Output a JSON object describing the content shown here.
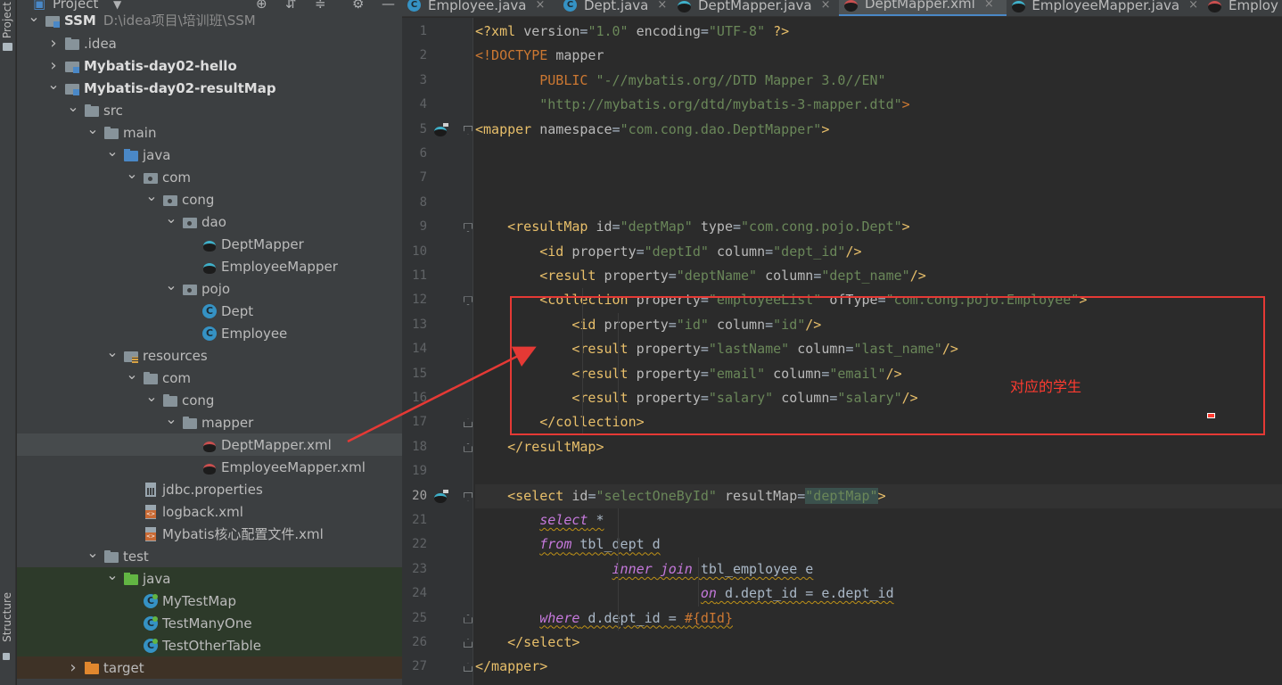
{
  "left_strip": {
    "project_label": "Project",
    "structure_label": "Structure"
  },
  "project_panel": {
    "title": "Project",
    "dropdown_icon": "chevron-down-icon",
    "toolbar_icons": [
      "target-icon",
      "collapse-all-icon",
      "expand-icon",
      "gear-icon",
      "minimize-icon"
    ],
    "tree": [
      {
        "label": "SSM",
        "path": "D:\\idea项目\\培训班\\SSM",
        "icon": "module",
        "depth": 0,
        "arrow": "down",
        "bold": true
      },
      {
        "label": ".idea",
        "icon": "folder",
        "depth": 1,
        "arrow": "right"
      },
      {
        "label": "Mybatis-day02-hello",
        "icon": "module",
        "depth": 1,
        "arrow": "right",
        "bold": true
      },
      {
        "label": "Mybatis-day02-resultMap",
        "icon": "module",
        "depth": 1,
        "arrow": "down",
        "bold": true
      },
      {
        "label": "src",
        "icon": "folder",
        "depth": 2,
        "arrow": "down"
      },
      {
        "label": "main",
        "icon": "folder",
        "depth": 3,
        "arrow": "down"
      },
      {
        "label": "java",
        "icon": "folder-src",
        "depth": 4,
        "arrow": "down"
      },
      {
        "label": "com",
        "icon": "folder-pkg",
        "depth": 5,
        "arrow": "down"
      },
      {
        "label": "cong",
        "icon": "folder-pkg",
        "depth": 6,
        "arrow": "down"
      },
      {
        "label": "dao",
        "icon": "folder-pkg",
        "depth": 7,
        "arrow": "down"
      },
      {
        "label": "DeptMapper",
        "icon": "mybatis",
        "depth": 8,
        "arrow": "none"
      },
      {
        "label": "EmployeeMapper",
        "icon": "mybatis",
        "depth": 8,
        "arrow": "none"
      },
      {
        "label": "pojo",
        "icon": "folder-pkg",
        "depth": 7,
        "arrow": "down"
      },
      {
        "label": "Dept",
        "icon": "class",
        "depth": 8,
        "arrow": "none"
      },
      {
        "label": "Employee",
        "icon": "class",
        "depth": 8,
        "arrow": "none"
      },
      {
        "label": "resources",
        "icon": "folder-res",
        "depth": 4,
        "arrow": "down"
      },
      {
        "label": "com",
        "icon": "folder",
        "depth": 5,
        "arrow": "down"
      },
      {
        "label": "cong",
        "icon": "folder",
        "depth": 6,
        "arrow": "down"
      },
      {
        "label": "mapper",
        "icon": "folder",
        "depth": 7,
        "arrow": "down"
      },
      {
        "label": "DeptMapper.xml",
        "icon": "mybatis-xml",
        "depth": 8,
        "arrow": "none",
        "selected": true
      },
      {
        "label": "EmployeeMapper.xml",
        "icon": "mybatis-xml",
        "depth": 8,
        "arrow": "none"
      },
      {
        "label": "jdbc.properties",
        "icon": "props",
        "depth": 5,
        "arrow": "none"
      },
      {
        "label": "logback.xml",
        "icon": "xml",
        "depth": 5,
        "arrow": "none"
      },
      {
        "label": "Mybatis核心配置文件.xml",
        "icon": "xml",
        "depth": 5,
        "arrow": "none"
      },
      {
        "label": "test",
        "icon": "folder",
        "depth": 3,
        "arrow": "down"
      },
      {
        "label": "java",
        "icon": "folder-test",
        "depth": 4,
        "arrow": "down",
        "test": true
      },
      {
        "label": "MyTestMap",
        "icon": "class-test",
        "depth": 5,
        "arrow": "none",
        "test": true
      },
      {
        "label": "TestManyOne",
        "icon": "class-test",
        "depth": 5,
        "arrow": "none",
        "test": true
      },
      {
        "label": "TestOtherTable",
        "icon": "class-test",
        "depth": 5,
        "arrow": "none",
        "test": true
      },
      {
        "label": "target",
        "icon": "folder-target",
        "depth": 2,
        "arrow": "right",
        "target": true
      }
    ]
  },
  "tabs": [
    {
      "label": "Employee.java",
      "icon": "c",
      "active": false
    },
    {
      "label": "Dept.java",
      "icon": "c",
      "active": false
    },
    {
      "label": "DeptMapper.java",
      "icon": "mb",
      "active": false
    },
    {
      "label": "DeptMapper.xml",
      "icon": "mbx",
      "active": true
    },
    {
      "label": "EmployeeMapper.java",
      "icon": "mb",
      "active": false
    },
    {
      "label": "Employ",
      "icon": "mbx",
      "active": false
    }
  ],
  "editor": {
    "current_line": 20,
    "gutter_icons": [
      5,
      20
    ],
    "lines": [
      {
        "n": 1,
        "indent": 0,
        "tokens": [
          [
            "decl",
            "<?xml "
          ],
          [
            "attr",
            "version"
          ],
          [
            "sql",
            "="
          ],
          [
            "val",
            "\"1.0\" "
          ],
          [
            "attr",
            "encoding"
          ],
          [
            "sql",
            "="
          ],
          [
            "val",
            "\"UTF-8\" "
          ],
          [
            "decl",
            "?>"
          ]
        ]
      },
      {
        "n": 2,
        "indent": 0,
        "tokens": [
          [
            "doctype",
            "<!DOCTYPE "
          ],
          [
            "attr",
            "mapper"
          ]
        ]
      },
      {
        "n": 3,
        "indent": 8,
        "tokens": [
          [
            "doctype",
            "PUBLIC "
          ],
          [
            "val",
            "\"-//mybatis.org//DTD Mapper 3.0//EN\""
          ]
        ]
      },
      {
        "n": 4,
        "indent": 8,
        "tokens": [
          [
            "val",
            "\"http://mybatis.org/dtd/mybatis-3-mapper.dtd\""
          ],
          [
            "doctype",
            ">"
          ]
        ]
      },
      {
        "n": 5,
        "indent": 0,
        "tokens": [
          [
            "tag",
            "<mapper "
          ],
          [
            "attr",
            "namespace"
          ],
          [
            "sql",
            "="
          ],
          [
            "val",
            "\"com.cong.dao.DeptMapper\""
          ],
          [
            "tag",
            ">"
          ]
        ]
      },
      {
        "n": 6,
        "indent": 0,
        "tokens": []
      },
      {
        "n": 7,
        "indent": 0,
        "tokens": []
      },
      {
        "n": 8,
        "indent": 0,
        "tokens": []
      },
      {
        "n": 9,
        "indent": 4,
        "tokens": [
          [
            "tag",
            "<resultMap "
          ],
          [
            "attr",
            "id"
          ],
          [
            "sql",
            "="
          ],
          [
            "val",
            "\"deptMap\" "
          ],
          [
            "attr",
            "type"
          ],
          [
            "sql",
            "="
          ],
          [
            "val",
            "\"com.cong.pojo.Dept\""
          ],
          [
            "tag",
            ">"
          ]
        ]
      },
      {
        "n": 10,
        "indent": 8,
        "tokens": [
          [
            "tag",
            "<id "
          ],
          [
            "attr",
            "property"
          ],
          [
            "sql",
            "="
          ],
          [
            "val",
            "\"deptId\" "
          ],
          [
            "attr",
            "column"
          ],
          [
            "sql",
            "="
          ],
          [
            "val",
            "\"dept_id\""
          ],
          [
            "tag",
            "/>"
          ]
        ]
      },
      {
        "n": 11,
        "indent": 8,
        "tokens": [
          [
            "tag",
            "<result "
          ],
          [
            "attr",
            "property"
          ],
          [
            "sql",
            "="
          ],
          [
            "val",
            "\"deptName\" "
          ],
          [
            "attr",
            "column"
          ],
          [
            "sql",
            "="
          ],
          [
            "val",
            "\"dept_name\""
          ],
          [
            "tag",
            "/>"
          ]
        ]
      },
      {
        "n": 12,
        "indent": 8,
        "tokens": [
          [
            "tag",
            "<collection "
          ],
          [
            "attr",
            "property"
          ],
          [
            "sql",
            "="
          ],
          [
            "val",
            "\"employeeList\" "
          ],
          [
            "attr",
            "ofType"
          ],
          [
            "sql",
            "="
          ],
          [
            "val",
            "\"com.cong.pojo.Employee\""
          ],
          [
            "tag",
            ">"
          ]
        ]
      },
      {
        "n": 13,
        "indent": 12,
        "tokens": [
          [
            "tag",
            "<id "
          ],
          [
            "attr",
            "property"
          ],
          [
            "sql",
            "="
          ],
          [
            "val",
            "\"id\" "
          ],
          [
            "attr",
            "column"
          ],
          [
            "sql",
            "="
          ],
          [
            "val",
            "\"id\""
          ],
          [
            "tag",
            "/>"
          ]
        ]
      },
      {
        "n": 14,
        "indent": 12,
        "tokens": [
          [
            "tag",
            "<result "
          ],
          [
            "attr",
            "property"
          ],
          [
            "sql",
            "="
          ],
          [
            "val",
            "\"lastName\" "
          ],
          [
            "attr",
            "column"
          ],
          [
            "sql",
            "="
          ],
          [
            "val",
            "\"last_name\""
          ],
          [
            "tag",
            "/>"
          ]
        ]
      },
      {
        "n": 15,
        "indent": 12,
        "tokens": [
          [
            "tag",
            "<result "
          ],
          [
            "attr",
            "property"
          ],
          [
            "sql",
            "="
          ],
          [
            "val",
            "\"email\" "
          ],
          [
            "attr",
            "column"
          ],
          [
            "sql",
            "="
          ],
          [
            "val",
            "\"email\""
          ],
          [
            "tag",
            "/>"
          ]
        ]
      },
      {
        "n": 16,
        "indent": 12,
        "tokens": [
          [
            "tag",
            "<result "
          ],
          [
            "attr",
            "property"
          ],
          [
            "sql",
            "="
          ],
          [
            "val",
            "\"salary\" "
          ],
          [
            "attr",
            "column"
          ],
          [
            "sql",
            "="
          ],
          [
            "val",
            "\"salary\""
          ],
          [
            "tag",
            "/>"
          ]
        ]
      },
      {
        "n": 17,
        "indent": 8,
        "tokens": [
          [
            "tag",
            "</collection>"
          ]
        ]
      },
      {
        "n": 18,
        "indent": 4,
        "tokens": [
          [
            "tag",
            "</resultMap>"
          ]
        ]
      },
      {
        "n": 19,
        "indent": 0,
        "tokens": []
      },
      {
        "n": 20,
        "indent": 4,
        "tokens": [
          [
            "tag",
            "<select "
          ],
          [
            "attr",
            "id"
          ],
          [
            "sql",
            "="
          ],
          [
            "val",
            "\"selectOneById\" "
          ],
          [
            "attr",
            "resultMap"
          ],
          [
            "sql",
            "="
          ],
          [
            "hlval",
            "\"deptMap\""
          ],
          [
            "tag",
            ">"
          ]
        ]
      },
      {
        "n": 21,
        "indent": 8,
        "wavy": true,
        "tokens": [
          [
            "sqlkw2",
            "select"
          ],
          [
            "sql",
            " *"
          ]
        ]
      },
      {
        "n": 22,
        "indent": 8,
        "wavy": true,
        "tokens": [
          [
            "sqlkw2",
            "from"
          ],
          [
            "sql",
            " tbl_dept d"
          ]
        ]
      },
      {
        "n": 23,
        "indent": 17,
        "wavy": true,
        "tokens": [
          [
            "sqlkw2",
            "inner join"
          ],
          [
            "sql",
            " tbl_employee e"
          ]
        ]
      },
      {
        "n": 24,
        "indent": 28,
        "wavy": true,
        "tokens": [
          [
            "sqlkw2",
            "on"
          ],
          [
            "sql",
            " d.dept_id = e.dept_id"
          ]
        ]
      },
      {
        "n": 25,
        "indent": 8,
        "wavy": true,
        "tokens": [
          [
            "sqlkw2",
            "where"
          ],
          [
            "sql",
            " d.dept_id = "
          ],
          [
            "brace",
            "#{dId}"
          ]
        ]
      },
      {
        "n": 26,
        "indent": 4,
        "tokens": [
          [
            "tag",
            "</select>"
          ]
        ]
      },
      {
        "n": 27,
        "indent": 0,
        "tokens": [
          [
            "tag",
            "</mapper>"
          ]
        ]
      }
    ]
  },
  "annotation": {
    "text": "对应的学生",
    "color": "#ff3b30"
  },
  "colors": {
    "panel_bg": "#3c3f41",
    "editor_bg": "#2b2b2b",
    "tag": "#e8bf6a",
    "value": "#6a8759",
    "accent": "#4a88c7"
  }
}
